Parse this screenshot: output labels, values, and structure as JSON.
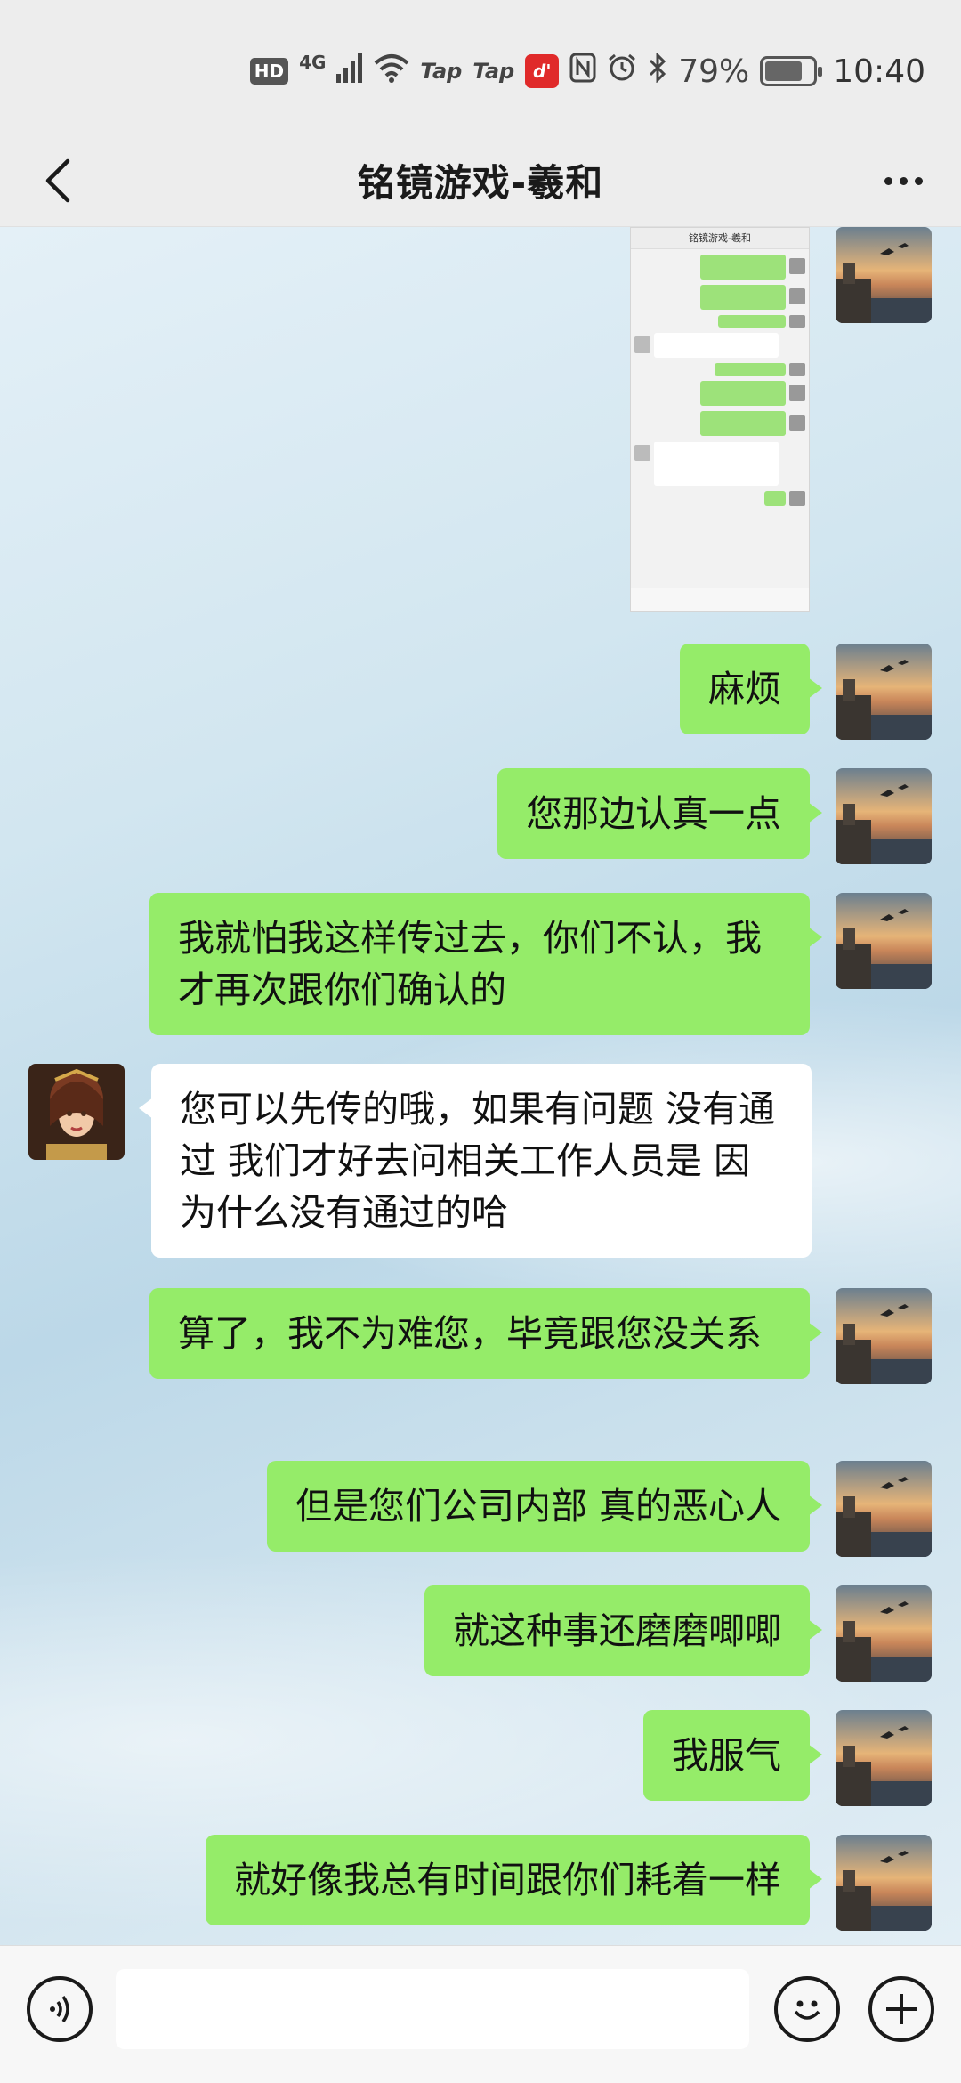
{
  "status_bar": {
    "hd": "HD",
    "network": "4G",
    "app1": "Tap",
    "app2": "Tap",
    "app3": "d'",
    "battery": "79%",
    "time": "10:40"
  },
  "header": {
    "title": "铭镜游戏-羲和"
  },
  "messages": [
    {
      "from": "self",
      "type": "image"
    },
    {
      "from": "self",
      "text": "麻烦"
    },
    {
      "from": "self",
      "text": "您那边认真一点"
    },
    {
      "from": "self",
      "text": "我就怕我这样传过去，你们不认，我才再次跟你们确认的"
    },
    {
      "from": "other",
      "text": "您可以先传的哦，如果有问题 没有通过 我们才好去问相关工作人员是 因为什么没有通过的哈"
    },
    {
      "from": "self",
      "text": "算了，我不为难您，毕竟跟您没关系"
    },
    {
      "from": "self",
      "text": "但是您们公司内部 真的恶心人"
    },
    {
      "from": "self",
      "text": "就这种事还磨磨唧唧"
    },
    {
      "from": "self",
      "text": "我服气"
    },
    {
      "from": "self",
      "text": "就好像我总有时间跟你们耗着一样"
    }
  ],
  "colors": {
    "mine_bubble": "#95ec69",
    "theirs_bubble": "#ffffff",
    "header_bg": "#ededed"
  },
  "icons": {
    "back": "chevron-left-icon",
    "more": "more-dots-icon",
    "voice": "voice-icon",
    "emoji": "emoji-icon",
    "plus": "plus-icon"
  }
}
